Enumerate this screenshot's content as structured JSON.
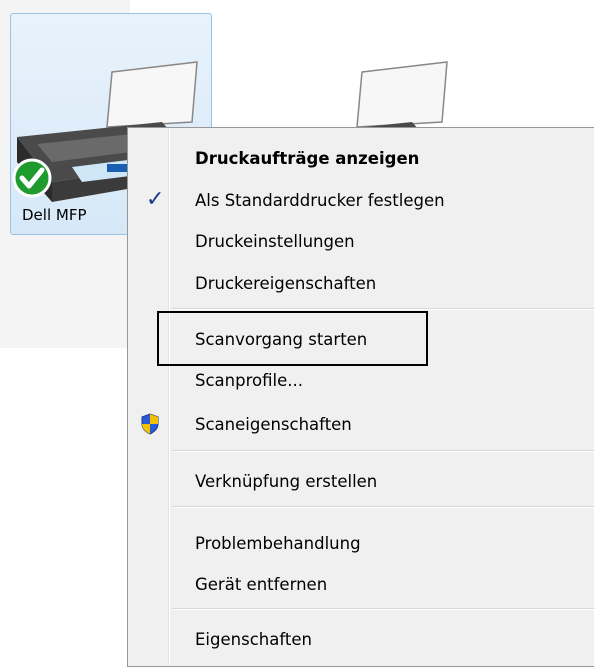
{
  "desktop": {
    "device_label": "Dell MFP",
    "default_badge_icon": "check-badge-icon",
    "printer_icon": "printer-icon"
  },
  "context_menu": {
    "items": [
      {
        "label": "Druckaufträge anzeigen",
        "bold": true,
        "icon": ""
      },
      {
        "label": "Als Standarddrucker festlegen",
        "bold": false,
        "icon": "checkmark-icon"
      },
      {
        "label": "Druckeinstellungen",
        "bold": false,
        "icon": ""
      },
      {
        "label": "Druckereigenschaften",
        "bold": false,
        "icon": ""
      },
      {
        "label": "Scanvorgang starten",
        "bold": false,
        "icon": ""
      },
      {
        "label": "Scanprofile...",
        "bold": false,
        "icon": ""
      },
      {
        "label": "Scaneigenschaften",
        "bold": false,
        "icon": "uac-shield-icon"
      },
      {
        "label": "Verknüpfung erstellen",
        "bold": false,
        "icon": ""
      },
      {
        "label": "Problembehandlung",
        "bold": false,
        "icon": ""
      },
      {
        "label": "Gerät entfernen",
        "bold": false,
        "icon": ""
      },
      {
        "label": "Eigenschaften",
        "bold": false,
        "icon": ""
      }
    ],
    "check_glyph": "✓"
  },
  "colors": {
    "selection_fill": "#d6e8f8",
    "selection_border": "#9cc3e6",
    "menu_background": "#f0f0f0",
    "checkmark": "#1a3a8a"
  }
}
